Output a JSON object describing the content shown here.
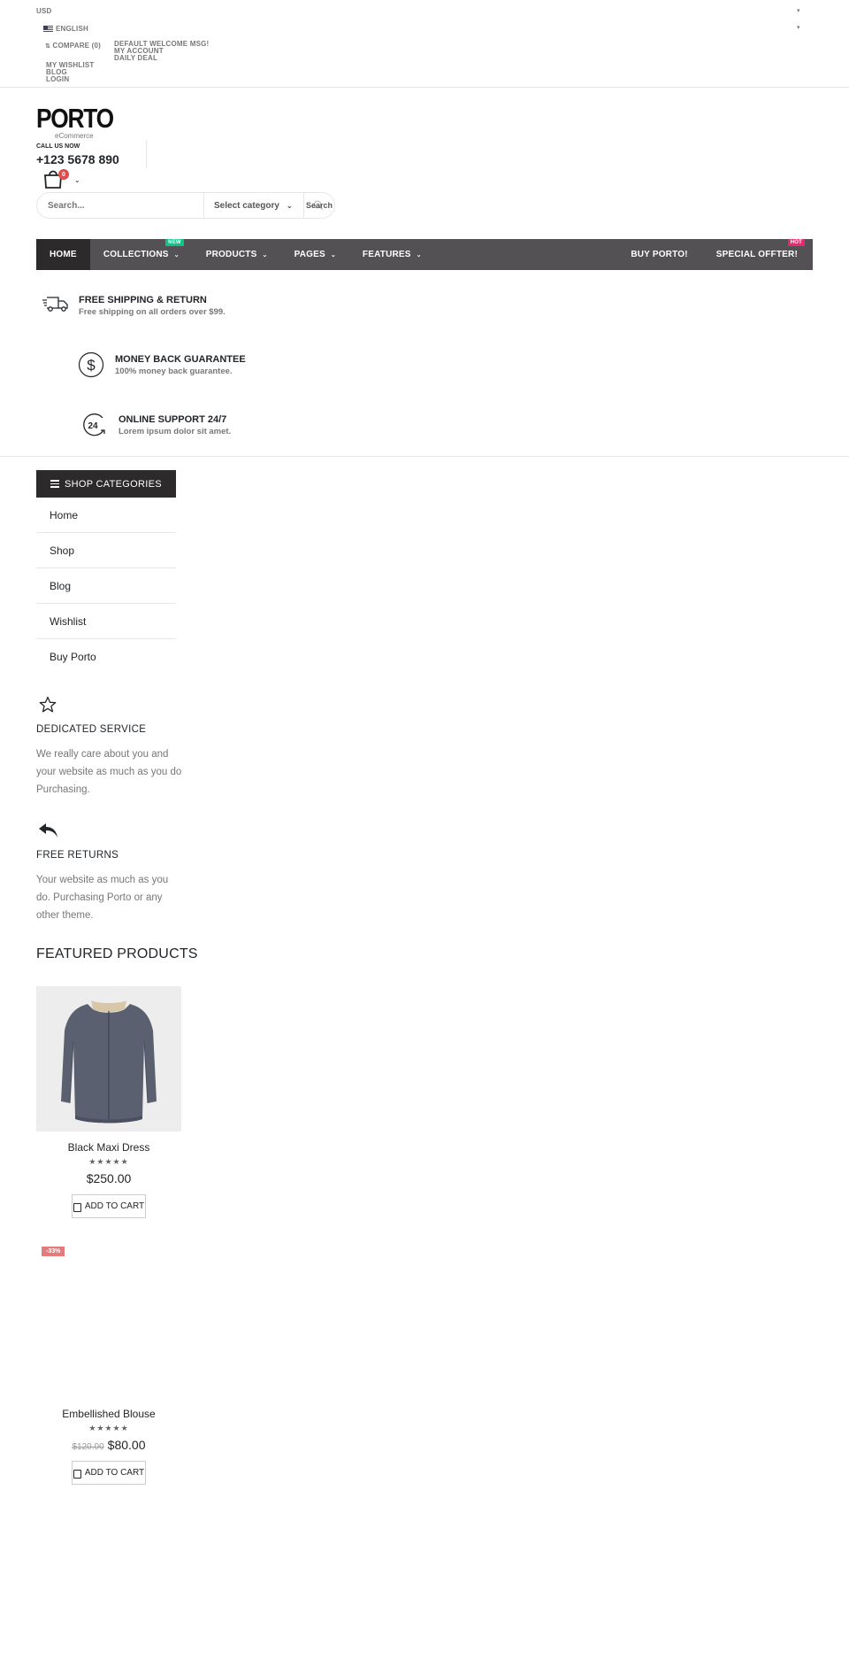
{
  "topbar": {
    "currency": "USD",
    "language": "ENGLISH",
    "compare": "COMPARE (0)",
    "welcome": "DEFAULT WELCOME MSG!",
    "my_account": "MY ACCOUNT",
    "daily_deal": "DAILY DEAL",
    "wishlist": "MY WISHLIST",
    "blog": "BLOG",
    "login": "LOGIN"
  },
  "header": {
    "logo": "PORTO",
    "logo_sub": "eCommerce",
    "call_label": "CALL US NOW",
    "phone": "+123 5678 890",
    "cart_count": "0"
  },
  "search": {
    "placeholder": "Search...",
    "category": "Select category",
    "button": "Search"
  },
  "nav": {
    "home": "Home",
    "collections": "Collections",
    "collections_badge": "NEW",
    "products": "Products",
    "pages": "Pages",
    "features": "Features",
    "buy": "Buy Porto!",
    "special": "Special Offter!",
    "special_badge": "HOT",
    "colors": {
      "bar": "#535154",
      "active": "#2d2a2b",
      "new_badge": "#0cc485",
      "hot_badge": "#eb2771"
    }
  },
  "features": [
    {
      "title": "FREE SHIPPING & RETURN",
      "sub": "Free shipping on all orders over $99.",
      "icon": "truck-icon"
    },
    {
      "title": "MONEY BACK GUARANTEE",
      "sub": "100% money back guarantee.",
      "icon": "dollar-icon"
    },
    {
      "title": "ONLINE SUPPORT 24/7",
      "sub": "Lorem ipsum dolor sit amet.",
      "icon": "support-24-icon",
      "icon_text": "24"
    }
  ],
  "sidebar": {
    "heading": "SHOP CATEGORIES",
    "items": [
      "Home",
      "Shop",
      "Blog",
      "Wishlist",
      "Buy Porto"
    ]
  },
  "services": [
    {
      "title": "DEDICATED SERVICE",
      "text": "We really care about you and your website as much as you do Purchasing.",
      "icon": "star-icon"
    },
    {
      "title": "FREE RETURNS",
      "text": "Your website as much as you do. Purchasing Porto or any other theme.",
      "icon": "reply-icon"
    }
  ],
  "featured": {
    "heading": "FEATURED PRODUCTS",
    "products": [
      {
        "name": "Black Maxi Dress",
        "price": "$250.00",
        "old_price": "",
        "rating": 5,
        "add_to_cart": "ADD TO CART",
        "label": ""
      },
      {
        "name": "Embellished Blouse",
        "price": "$80.00",
        "old_price": "$120.00",
        "rating": 5,
        "add_to_cart": "ADD TO CART",
        "label": "-33%"
      }
    ]
  }
}
